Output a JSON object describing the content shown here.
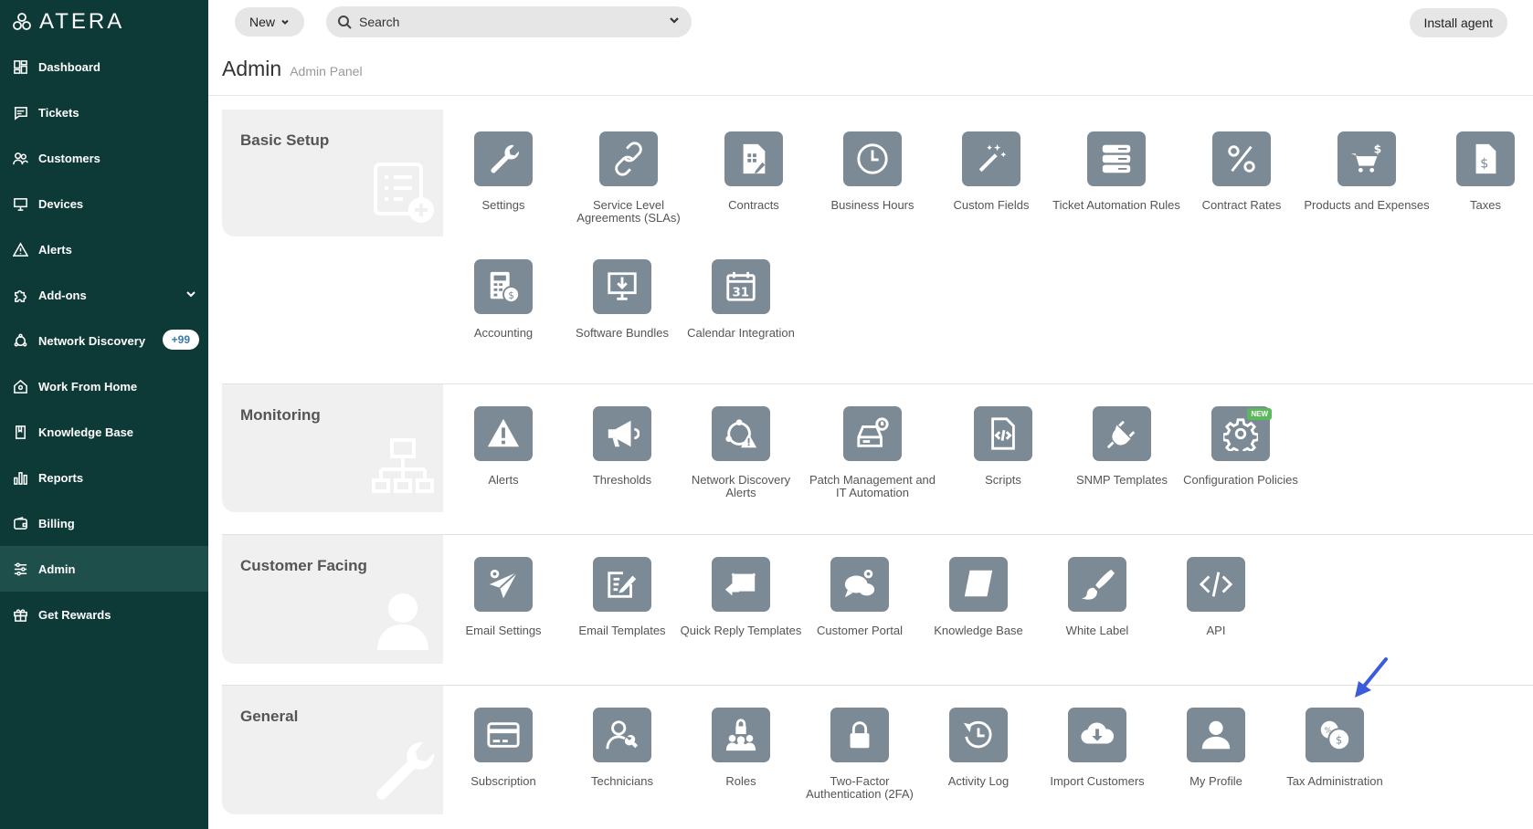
{
  "brand": {
    "name": "ATERA"
  },
  "sidebar": {
    "items": [
      {
        "label": "Dashboard",
        "icon": "dashboard-icon"
      },
      {
        "label": "Tickets",
        "icon": "ticket-icon"
      },
      {
        "label": "Customers",
        "icon": "customers-icon"
      },
      {
        "label": "Devices",
        "icon": "monitor-icon"
      },
      {
        "label": "Alerts",
        "icon": "warning-icon"
      },
      {
        "label": "Add-ons",
        "icon": "puzzle-icon"
      },
      {
        "label": "Network Discovery",
        "icon": "network-icon",
        "badge": "+99"
      },
      {
        "label": "Work From Home",
        "icon": "home-icon"
      },
      {
        "label": "Knowledge Base",
        "icon": "book-icon"
      },
      {
        "label": "Reports",
        "icon": "bar-chart-icon"
      },
      {
        "label": "Billing",
        "icon": "wallet-icon"
      },
      {
        "label": "Admin",
        "icon": "sliders-icon",
        "active": true
      },
      {
        "label": "Get Rewards",
        "icon": "gift-icon"
      }
    ]
  },
  "topbar": {
    "new_label": "New",
    "search_placeholder": "Search",
    "install_label": "Install agent"
  },
  "header": {
    "title": "Admin",
    "subtitle": "Admin Panel"
  },
  "sections": {
    "basic": {
      "title": "Basic Setup",
      "tiles": [
        "Settings",
        "Service Level Agreements (SLAs)",
        "Contracts",
        "Business Hours",
        "Custom Fields",
        "Ticket Automation Rules",
        "Contract Rates",
        "Products and Expenses",
        "Taxes",
        "Accounting",
        "Software Bundles",
        "Calendar Integration"
      ]
    },
    "monitoring": {
      "title": "Monitoring",
      "tiles": [
        "Alerts",
        "Thresholds",
        "Network Discovery Alerts",
        "Patch Management and IT Automation",
        "Scripts",
        "SNMP Templates",
        "Configuration Policies"
      ],
      "new_badge": "NEW"
    },
    "customer": {
      "title": "Customer Facing",
      "tiles": [
        "Email Settings",
        "Email Templates",
        "Quick Reply Templates",
        "Customer Portal",
        "Knowledge Base",
        "White Label",
        "API"
      ]
    },
    "general": {
      "title": "General",
      "tiles": [
        "Subscription",
        "Technicians",
        "Roles",
        "Two-Factor Authentication (2FA)",
        "Activity Log",
        "Import Customers",
        "My Profile",
        "Tax Administration"
      ]
    }
  },
  "colors": {
    "sidebar_bg": "#0d3a36",
    "tile_bg": "#7c8a96",
    "accent": "#3b5bdb"
  }
}
